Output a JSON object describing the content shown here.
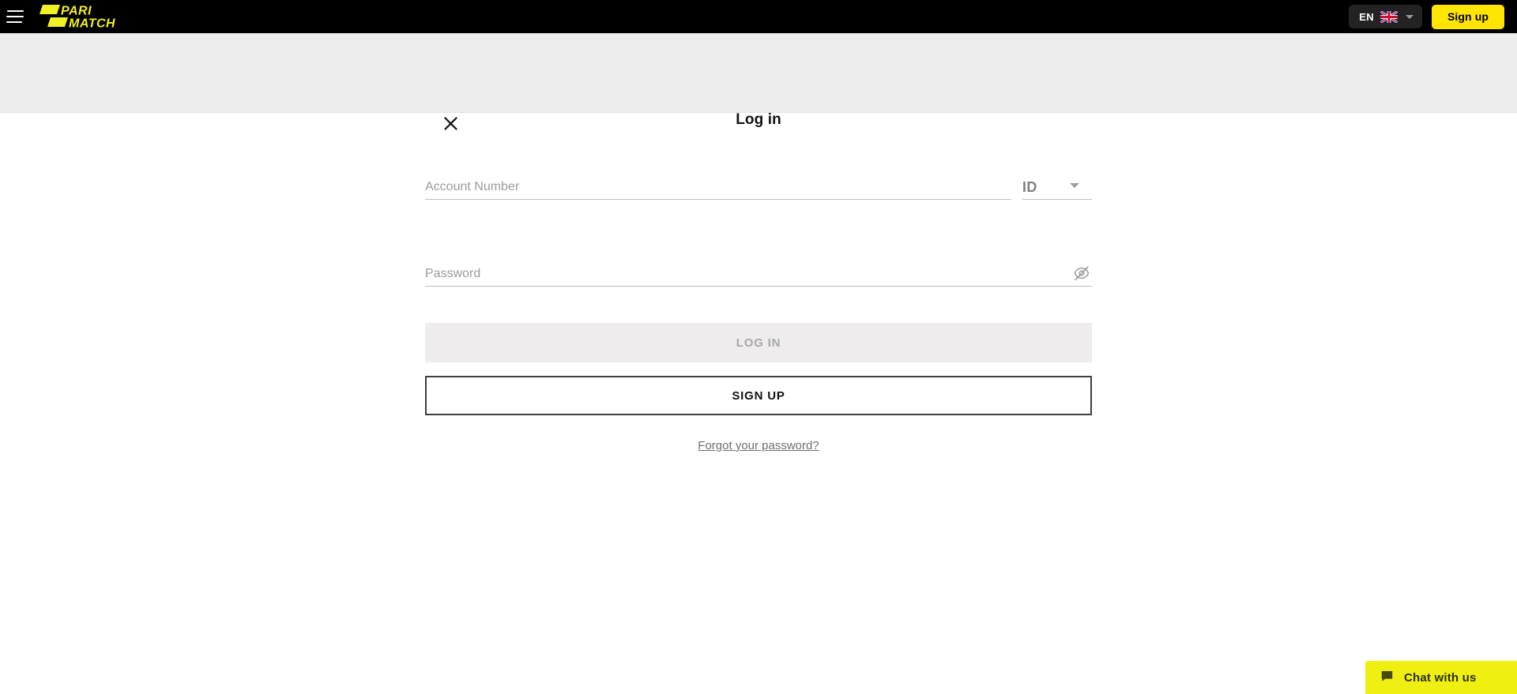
{
  "topbar": {
    "menu_icon": "hamburger-menu-icon",
    "logo_text_line1": "PARI",
    "logo_text_line2": "MATCH",
    "language_code": "EN",
    "language_flag": "uk-flag-icon",
    "language_caret": "chevron-down-icon",
    "signup_label": "Sign up",
    "bg_color": "#000000",
    "accent_color": "#ffe500"
  },
  "modal": {
    "title": "Log in",
    "close_icon": "close-x-icon",
    "header_bg": "#ededed"
  },
  "form": {
    "account": {
      "placeholder": "Account Number",
      "value": ""
    },
    "account_type": {
      "selected": "ID",
      "caret_icon": "caret-down-icon"
    },
    "password": {
      "placeholder": "Password",
      "value": "",
      "toggle_icon": "eye-off-icon"
    },
    "login_button": {
      "label": "LOG IN",
      "disabled": true,
      "bg_color": "#eeecec",
      "text_color": "#a8a8a8"
    },
    "signup_button": {
      "label": "SIGN UP",
      "border_color": "#3f3f3f"
    },
    "forgot_link": "Forgot your password?"
  },
  "chat_widget": {
    "label": "Chat with us",
    "icon": "chat-bubble-icon",
    "bg_color": "#efef12"
  }
}
